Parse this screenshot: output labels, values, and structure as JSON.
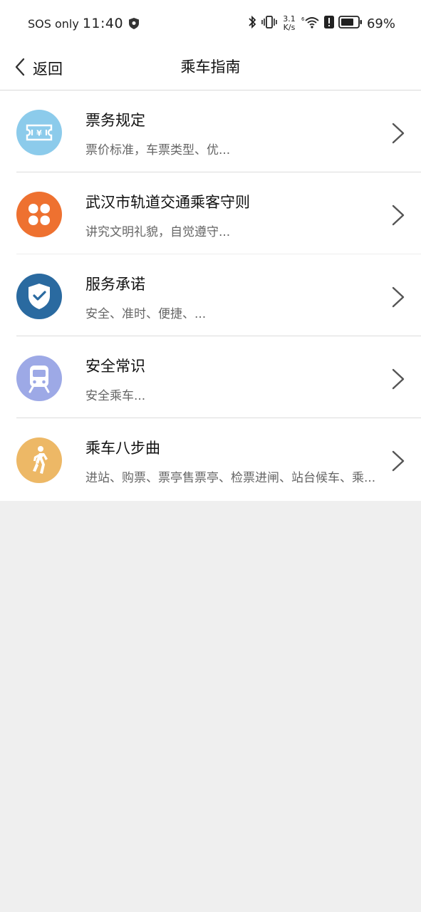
{
  "status_bar": {
    "carrier": "SOS only",
    "time": "11:40",
    "speed_value": "3.1",
    "speed_unit": "K/s",
    "battery_pct": "69%"
  },
  "nav": {
    "back_label": "返回",
    "title": "乘车指南"
  },
  "items": [
    {
      "title": "票务规定",
      "subtitle": "票价标准，车票类型、优...",
      "icon": "ticket-icon",
      "color": "#8ccbeb"
    },
    {
      "title": "武汉市轨道交通乘客守则",
      "subtitle": "讲究文明礼貌，自觉遵守...",
      "icon": "clover-icon",
      "color": "#ee7130"
    },
    {
      "title": "服务承诺",
      "subtitle": "安全、准时、便捷、...",
      "icon": "shield-check-icon",
      "color": "#2a6aa0"
    },
    {
      "title": "安全常识",
      "subtitle": "安全乘车...",
      "icon": "train-icon",
      "color": "#9da9e6"
    },
    {
      "title": "乘车八步曲",
      "subtitle": "进站、购票、票亭售票亭、检票进闸、站台候车、乘...",
      "icon": "walking-person-icon",
      "color": "#edb866"
    }
  ]
}
